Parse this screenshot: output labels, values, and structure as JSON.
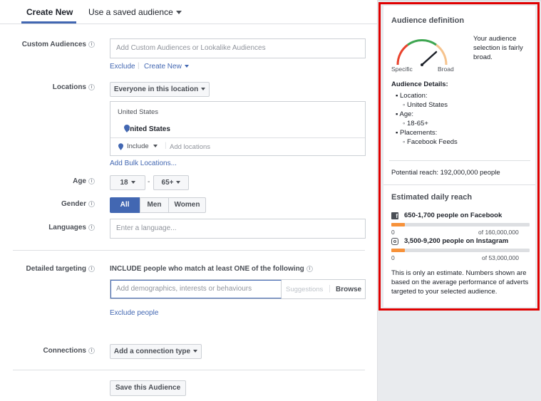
{
  "tabs": {
    "create_new": "Create New",
    "saved": "Use a saved audience"
  },
  "custom_audiences": {
    "label": "Custom Audiences",
    "placeholder": "Add Custom Audiences or Lookalike Audiences",
    "exclude": "Exclude",
    "create_new": "Create New"
  },
  "locations": {
    "label": "Locations",
    "dropdown": "Everyone in this location",
    "country_header": "United States",
    "selected": "United States",
    "include": "Include",
    "add_placeholder": "Add locations",
    "bulk": "Add Bulk Locations..."
  },
  "age": {
    "label": "Age",
    "min": "18",
    "max": "65+",
    "dash": "-"
  },
  "gender": {
    "label": "Gender",
    "options": [
      "All",
      "Men",
      "Women"
    ],
    "selected": "All"
  },
  "languages": {
    "label": "Languages",
    "placeholder": "Enter a language..."
  },
  "detailed": {
    "label": "Detailed targeting",
    "include_text": "INCLUDE people who match at least ONE of the following",
    "placeholder": "Add demographics, interests or behaviours",
    "suggestions": "Suggestions",
    "browse": "Browse",
    "exclude": "Exclude people"
  },
  "connections": {
    "label": "Connections",
    "button": "Add a connection type"
  },
  "save_button": "Save this Audience",
  "audience_definition": {
    "title": "Audience definition",
    "gauge_left": "Specific",
    "gauge_right": "Broad",
    "summary": "Your audience selection is fairly broad.",
    "details_title": "Audience Details:",
    "location_label": "Location:",
    "location_value": "United States",
    "age_label": "Age:",
    "age_value": "18-65+",
    "placements_label": "Placements:",
    "placements_value": "Facebook Feeds",
    "potential_reach": "Potential reach: 192,000,000 people"
  },
  "daily_reach": {
    "title": "Estimated daily reach",
    "facebook": {
      "text": "650-1,700 people on Facebook",
      "min": "0",
      "max": "of 160,000,000",
      "fill_fraction": 0.1
    },
    "instagram": {
      "text": "3,500-9,200 people on Instagram",
      "min": "0",
      "max": "of 53,000,000",
      "fill_fraction": 0.1
    },
    "note": "This is only an estimate. Numbers shown are based on the average performance of adverts targeted to your selected audience."
  },
  "colors": {
    "accent": "#4267b2",
    "reach_bar": "#f7923a",
    "highlight_border": "#e00000"
  }
}
